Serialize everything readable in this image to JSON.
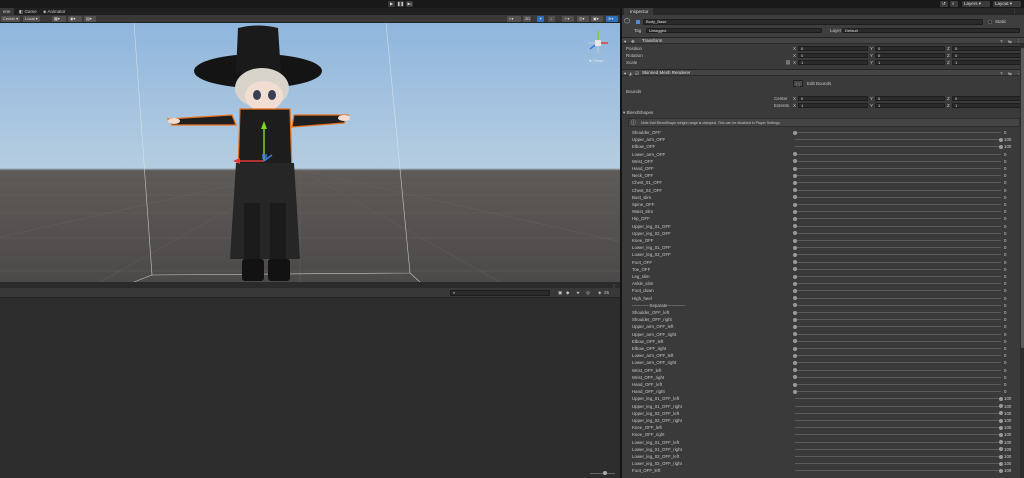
{
  "topbar": {
    "play_icon": "play-icon",
    "pause_icon": "pause-icon",
    "step_icon": "step-icon",
    "layers_label": "Layers",
    "layout_label": "Layout"
  },
  "scene_tabs": [
    {
      "label": "ene",
      "active": true
    },
    {
      "label": "Game",
      "active": false
    },
    {
      "label": "Animator",
      "active": false
    }
  ],
  "scene_toolbar": {
    "pivot_label": "Center",
    "space_label": "Local",
    "persp_label": "< Persp"
  },
  "inspector": {
    "tab_label": "Inspector",
    "object_name": "Body_Base",
    "static_label": "Static",
    "tag_label": "Tag",
    "tag_value": "Untagged",
    "layer_label": "Layer",
    "layer_value": "Default",
    "transform": {
      "title": "Transform",
      "position_label": "Position",
      "rotation_label": "Rotation",
      "scale_label": "Scale",
      "position": {
        "x": "0",
        "y": "0",
        "z": "0"
      },
      "rotation": {
        "x": "0",
        "y": "0",
        "z": "0"
      },
      "scale": {
        "x": "1",
        "y": "1",
        "z": "1"
      }
    },
    "smr": {
      "title": "Skinned Mesh Renderer",
      "edit_bounds_label": "Edit Bounds",
      "bounds_label": "Bounds",
      "center_label": "Center",
      "extents_label": "Extents",
      "center": {
        "x": "0",
        "y": "0",
        "z": "0"
      },
      "extents": {
        "x": "1",
        "y": "1",
        "z": "1"
      },
      "blendshapes_label": "BlendShapes",
      "warning": "Note that BlendShape weight range is clamped. This can be disabled in Player Settings."
    },
    "blendshapes": [
      {
        "name": "Shoulder_OFF",
        "value": 0
      },
      {
        "name": "Upper_arm_OFF",
        "value": 100
      },
      {
        "name": "Elbow_OFF",
        "value": 100
      },
      {
        "name": "Lower_arm_OFF",
        "value": 0
      },
      {
        "name": "Wrist_OFF",
        "value": 0
      },
      {
        "name": "Hand_OFF",
        "value": 0
      },
      {
        "name": "Neck_OFF",
        "value": 0
      },
      {
        "name": "Chest_01_OFF",
        "value": 0
      },
      {
        "name": "Chest_02_OFF",
        "value": 0
      },
      {
        "name": "Bust_slim",
        "value": 0
      },
      {
        "name": "Spine_OFF",
        "value": 0
      },
      {
        "name": "Waist_slim",
        "value": 0
      },
      {
        "name": "Hip_OFF",
        "value": 0
      },
      {
        "name": "Upper_leg_01_OFF",
        "value": 0
      },
      {
        "name": "Upper_leg_02_OFF",
        "value": 0
      },
      {
        "name": "Knee_OFF",
        "value": 0
      },
      {
        "name": "Lower_leg_01_OFF",
        "value": 0
      },
      {
        "name": "Lower_leg_02_OFF",
        "value": 0
      },
      {
        "name": "Foot_OFF",
        "value": 0
      },
      {
        "name": "Toe_OFF",
        "value": 0
      },
      {
        "name": "Leg_slim",
        "value": 0
      },
      {
        "name": "Ankle_slim",
        "value": 0
      },
      {
        "name": "Foot_down",
        "value": 0
      },
      {
        "name": "High_heel",
        "value": 0
      },
      {
        "name": "------------Separate------------",
        "value": 0
      },
      {
        "name": "Shoulder_OFF_left",
        "value": 0
      },
      {
        "name": "Shoulder_OFF_right",
        "value": 0
      },
      {
        "name": "Upper_arm_OFF_left",
        "value": 0
      },
      {
        "name": "Upper_arm_OFF_right",
        "value": 0
      },
      {
        "name": "Elbow_OFF_left",
        "value": 0
      },
      {
        "name": "Elbow_OFF_right",
        "value": 0
      },
      {
        "name": "Lower_arm_OFF_left",
        "value": 0
      },
      {
        "name": "Lower_arm_OFF_right",
        "value": 0
      },
      {
        "name": "Wrist_OFF_left",
        "value": 0
      },
      {
        "name": "Wrist_OFF_right",
        "value": 0
      },
      {
        "name": "Hand_OFF_left",
        "value": 0
      },
      {
        "name": "Hand_OFF_right",
        "value": 0
      },
      {
        "name": "Upper_leg_01_OFF_left",
        "value": 100
      },
      {
        "name": "Upper_leg_01_OFF_right",
        "value": 100
      },
      {
        "name": "Upper_leg_02_OFF_left",
        "value": 100
      },
      {
        "name": "Upper_leg_02_OFF_right",
        "value": 100
      },
      {
        "name": "Knee_OFF_left",
        "value": 100
      },
      {
        "name": "Knee_OFF_right",
        "value": 100
      },
      {
        "name": "Lower_leg_01_OFF_left",
        "value": 100
      },
      {
        "name": "Lower_leg_01_OFF_right",
        "value": 100
      },
      {
        "name": "Lower_leg_02_OFF_left",
        "value": 100
      },
      {
        "name": "Lower_leg_02_OFF_right",
        "value": 100
      },
      {
        "name": "Foot_OFF_left",
        "value": 100
      }
    ]
  },
  "project": {
    "search_placeholder": "",
    "count_label": "25"
  },
  "gizmo": {
    "view_label": "◄ Persp"
  },
  "colors": {
    "selection_outline": "#e8701a",
    "axis_x": "#e23a3a",
    "axis_y": "#7ed321",
    "axis_z": "#3a7de2",
    "accent": "#2f6fbf"
  }
}
